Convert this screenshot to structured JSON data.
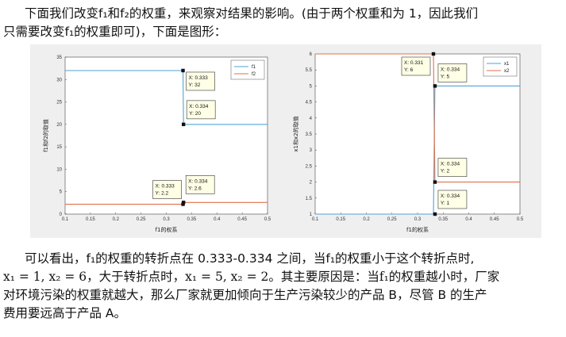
{
  "para1": {
    "line1": "下面我们改变f₁和f₂的权重，来观察对结果的影响。(由于两个权重和为 1，因此我们",
    "line2": "只需要改变f₁的权重即可)，下面是图形："
  },
  "para2": {
    "line1": "可以看出，f₁的权重的转折点在 0.333-0.334 之间，当f₁的权重小于这个转折点时,",
    "line2": "x₁ = 1, x₂ = 6，大于转折点时，x₁ = 5, x₂ = 2。其主要原因是：当f₁的权重越小时，厂家",
    "line3": "对环境污染的权重就越大，那么厂家就更加倾向于生产污染较少的产品 B，尽管 B 的生产",
    "line4": "费用要远高于产品 A。"
  },
  "colors": {
    "series1": "#4fa3d6",
    "series2": "#e0714a",
    "figure_bg": "#efefef"
  },
  "chart_data": [
    {
      "type": "line",
      "title": "",
      "xlabel": "f1的权系",
      "ylabel": "f1和f2的取值",
      "xlim": [
        0.1,
        0.5
      ],
      "ylim": [
        0,
        35
      ],
      "xticks": [
        "0.1",
        "0.15",
        "0.2",
        "0.25",
        "0.3",
        "0.35",
        "0.4",
        "0.45",
        "0.5"
      ],
      "yticks": [
        "0",
        "5",
        "10",
        "15",
        "20",
        "25",
        "30",
        "35"
      ],
      "legend": {
        "position": "top-right",
        "entries": [
          "f1",
          "f2"
        ]
      },
      "series": [
        {
          "name": "f1",
          "x": [
            0.1,
            0.333,
            0.334,
            0.5
          ],
          "y": [
            32,
            32,
            20,
            20
          ]
        },
        {
          "name": "f2",
          "x": [
            0.1,
            0.333,
            0.334,
            0.5
          ],
          "y": [
            2.2,
            2.2,
            2.6,
            2.6
          ]
        }
      ],
      "datatips": [
        {
          "x": 0.333,
          "y": 32,
          "label_x": "X: 0.333",
          "label_y": "Y: 32"
        },
        {
          "x": 0.334,
          "y": 20,
          "label_x": "X: 0.334",
          "label_y": "Y: 20"
        },
        {
          "x": 0.333,
          "y": 2.2,
          "label_x": "X: 0.333",
          "label_y": "Y: 2.2"
        },
        {
          "x": 0.334,
          "y": 2.6,
          "label_x": "X: 0.334",
          "label_y": "Y: 2.6"
        }
      ]
    },
    {
      "type": "line",
      "title": "",
      "xlabel": "f1的权系",
      "ylabel": "x1和x2的取值",
      "xlim": [
        0.1,
        0.5
      ],
      "ylim": [
        1,
        6
      ],
      "xticks": [
        "0.1",
        "0.15",
        "0.2",
        "0.25",
        "0.3",
        "0.35",
        "0.4",
        "0.45",
        "0.5"
      ],
      "yticks": [
        "1",
        "1.5",
        "2",
        "2.5",
        "3",
        "3.5",
        "4",
        "4.5",
        "5",
        "5.5",
        "6"
      ],
      "legend": {
        "position": "top-right",
        "entries": [
          "x1",
          "x2"
        ]
      },
      "series": [
        {
          "name": "x1",
          "x": [
            0.1,
            0.331,
            0.334,
            0.5
          ],
          "y": [
            1,
            1,
            5,
            5
          ]
        },
        {
          "name": "x2",
          "x": [
            0.1,
            0.331,
            0.334,
            0.5
          ],
          "y": [
            6,
            6,
            2,
            2
          ]
        }
      ],
      "datatips": [
        {
          "x": 0.331,
          "y": 6,
          "label_x": "X: 0.331",
          "label_y": "Y: 6"
        },
        {
          "x": 0.334,
          "y": 5,
          "label_x": "X: 0.334",
          "label_y": "Y: 5"
        },
        {
          "x": 0.334,
          "y": 2,
          "label_x": "X: 0.334",
          "label_y": "Y: 2"
        },
        {
          "x": 0.334,
          "y": 1,
          "label_x": "X: 0.334",
          "label_y": "Y: 1"
        }
      ]
    }
  ]
}
